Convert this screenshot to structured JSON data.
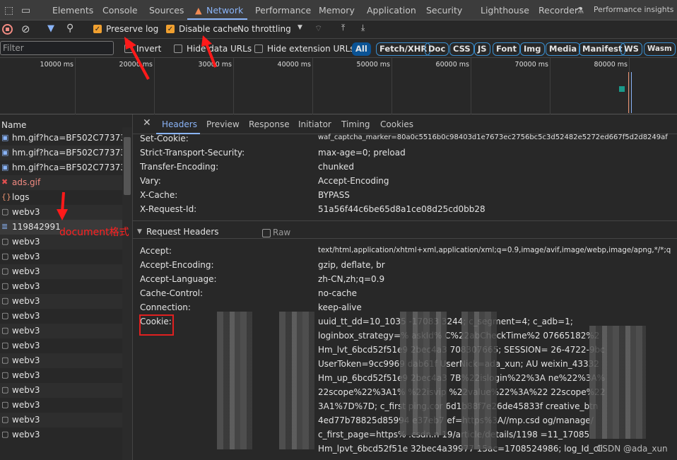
{
  "tabs": [
    "Elements",
    "Console",
    "Sources",
    "Network",
    "Performance",
    "Memory",
    "Application",
    "Security",
    "Lighthouse",
    "Recorder",
    "Performance insights"
  ],
  "active_tab": "Network",
  "toolbar": {
    "preserve_log": "Preserve log",
    "preserve_log_checked": true,
    "disable_cache": "Disable cache",
    "disable_cache_checked": true,
    "throttling": "No throttling"
  },
  "filter": {
    "placeholder": "Filter",
    "invert": "Invert",
    "hide_data_urls": "Hide data URLs",
    "hide_extension_urls": "Hide extension URLs",
    "types": [
      "All",
      "Fetch/XHR",
      "Doc",
      "CSS",
      "JS",
      "Font",
      "Img",
      "Media",
      "Manifest",
      "WS",
      "Wasm"
    ]
  },
  "timeline": {
    "ticks": [
      "10000 ms",
      "20000 ms",
      "30000 ms",
      "40000 ms",
      "50000 ms",
      "60000 ms",
      "70000 ms",
      "80000 ms"
    ]
  },
  "list": {
    "header": "Name",
    "rows": [
      {
        "name": "hm.gif?hca=BF502C773731...",
        "type": "image"
      },
      {
        "name": "hm.gif?hca=BF502C773731...",
        "type": "image"
      },
      {
        "name": "hm.gif?hca=BF502C773731...",
        "type": "image"
      },
      {
        "name": "ads.gif",
        "type": "error"
      },
      {
        "name": "logs",
        "type": "script"
      },
      {
        "name": "webv3",
        "type": "other"
      },
      {
        "name": "119842991",
        "type": "document",
        "selected": true
      },
      {
        "name": "webv3",
        "type": "other"
      },
      {
        "name": "webv3",
        "type": "other"
      },
      {
        "name": "webv3",
        "type": "other"
      },
      {
        "name": "webv3",
        "type": "other"
      },
      {
        "name": "webv3",
        "type": "other"
      },
      {
        "name": "webv3",
        "type": "other"
      },
      {
        "name": "webv3",
        "type": "other"
      },
      {
        "name": "webv3",
        "type": "other"
      },
      {
        "name": "webv3",
        "type": "other"
      },
      {
        "name": "webv3",
        "type": "other"
      },
      {
        "name": "webv3",
        "type": "other"
      },
      {
        "name": "webv3",
        "type": "other"
      },
      {
        "name": "webv3",
        "type": "other"
      },
      {
        "name": "webv3",
        "type": "other"
      }
    ]
  },
  "detail": {
    "tabs": [
      "Headers",
      "Preview",
      "Response",
      "Initiator",
      "Timing",
      "Cookies"
    ],
    "active": "Headers",
    "response_headers": [
      [
        "Set-Cookie:",
        "waf_captcha_marker=80a0c5516b0c98403d1e7673ec2756bc5c3d52482e5272ed667f5d2d8249af"
      ],
      [
        "Strict-Transport-Security:",
        "max-age=0; preload"
      ],
      [
        "Transfer-Encoding:",
        "chunked"
      ],
      [
        "Vary:",
        "Accept-Encoding"
      ],
      [
        "X-Cache:",
        "BYPASS"
      ],
      [
        "X-Request-Id:",
        "51a56f44c6be65d8a1ce08d25cd0bb28"
      ]
    ],
    "request_headers_title": "Request Headers",
    "raw": "Raw",
    "request_headers": [
      [
        "Accept:",
        "text/html,application/xhtml+xml,application/xml;q=0.9,image/avif,image/webp,image/apng,*/*;q"
      ],
      [
        "Accept-Encoding:",
        "gzip, deflate, br"
      ],
      [
        "Accept-Language:",
        "zh-CN,zh;q=0.9"
      ],
      [
        "Cache-Control:",
        "no-cache"
      ],
      [
        "Connection:",
        "keep-alive"
      ],
      [
        "Cookie:",
        "uuid_tt_dd=10_1035                  -17083                  3244; c_segment=4; c_adb=1;"
      ]
    ],
    "cookie_lines": [
      "loginbox_strategy=%                askId%                 C%22abCheckTime%2                 07665182%2",
      "Hm_lvt_6bcd52f51e9              2bec4a3                  708307665; SESSION=                26-4722-9bc",
      "UserToken=9cc9969                dab61f                  UserNick=ada_xun; AU               weixin_43332",
      "Hm_up_6bcd52f51e9              2bec4a3                   7B%22islogin%22%3A               ne%22%3A%",
      "22scope%22%3A1%               %22isvip                  %22value%22%3A%22               22scope%22",
      "3A1%7D%7D; c_first              ping.cor                 6d1b88f7e26de45833f               creative_btn",
      "4ed77b78825d85994              e37eb7                    ef=https%3A//mp.csd               og/manage/",
      "c_first_page=https%              .csdn.n                  19/article/details/1198              =11_17085",
      "Hm_lpvt_6bcd52f51e              32bec4a39977 15ac=1708524986; log_Id_cli"
    ]
  },
  "annotations": {
    "document_label": "document格式",
    "watermark": "CSDN @ada_xun"
  }
}
